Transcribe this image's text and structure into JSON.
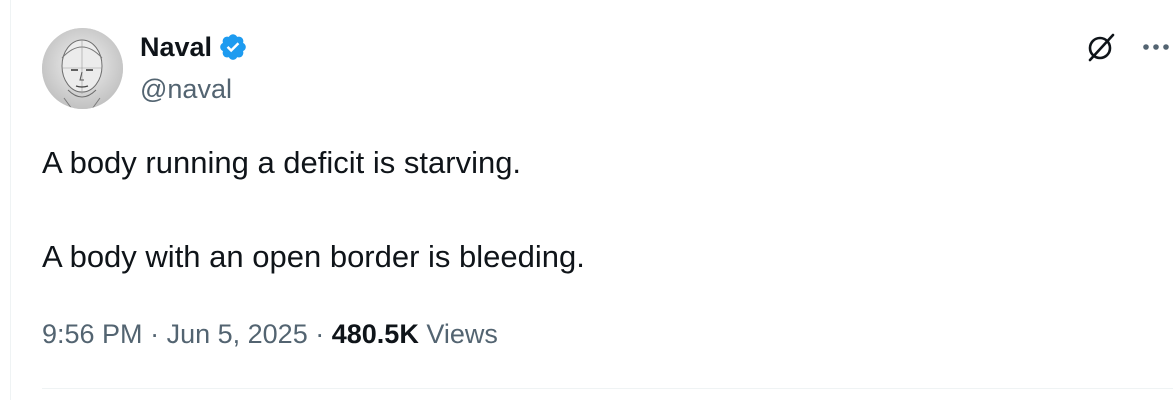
{
  "author": {
    "display_name": "Naval",
    "handle": "@naval",
    "verified": true,
    "avatar_icon": "pencil-sketch-face-avatar"
  },
  "tweet": {
    "paragraphs": [
      "A body running a deficit is starving.",
      "A body with an open border is bleeding."
    ]
  },
  "meta": {
    "time": "9:56 PM",
    "separator": "·",
    "date": "Jun 5, 2025",
    "views_count": "480.5K",
    "views_label": "Views"
  },
  "icons": {
    "grok": "grok-icon",
    "more": "more-options-icon",
    "verified": "verified-badge-icon"
  },
  "colors": {
    "text_primary": "#0f1419",
    "text_secondary": "#536471",
    "verified_blue": "#1d9bf0",
    "divider": "#eff3f4"
  }
}
